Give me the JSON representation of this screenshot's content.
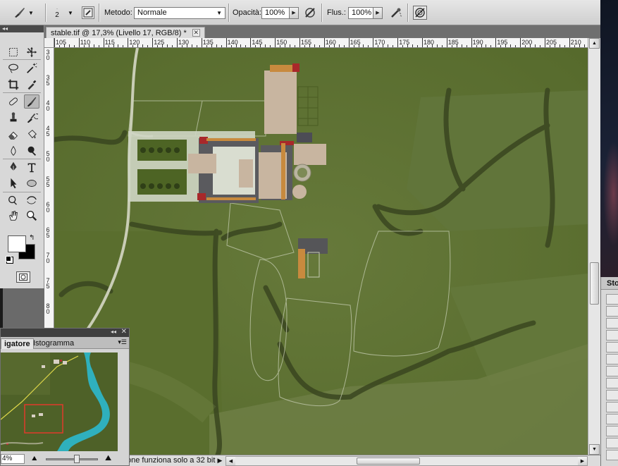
{
  "options_bar": {
    "brush_size": "2",
    "mode_label": "Metodo:",
    "mode_value": "Normale",
    "opacity_label": "Opacità:",
    "opacity_value": "100%",
    "flow_label": "Flus.:",
    "flow_value": "100%",
    "icons": [
      "brush-preset-icon",
      "brush-panel-icon",
      "airbrush-icon",
      "tablet-pressure-icon"
    ]
  },
  "document": {
    "tab_title": "stable.tif @ 17,3% (Livello 17, RGB/8) *",
    "close_label": "✕",
    "ruler_h": [
      "105",
      "110",
      "115",
      "120",
      "125",
      "130",
      "135",
      "140",
      "145",
      "150",
      "155",
      "160",
      "165",
      "170",
      "175",
      "180",
      "185",
      "190",
      "195",
      "200",
      "205",
      "210"
    ],
    "ruler_v": [
      "3 0",
      "3 5",
      "4 0",
      "4 5",
      "5 0",
      "5 5",
      "6 0",
      "6 5",
      "7 0",
      "7 5",
      "8 0"
    ],
    "status_text": "one funziona solo a 32 bit"
  },
  "navigator": {
    "tabs": [
      "igatore",
      "Istogramma"
    ],
    "zoom_value": "4%"
  },
  "history": {
    "title": "Sto"
  },
  "colors": {
    "foreground": "#ffffff",
    "background": "#000000",
    "field": "#5f7131",
    "road": "#c9cdb6",
    "river": "#2fb0bd"
  }
}
